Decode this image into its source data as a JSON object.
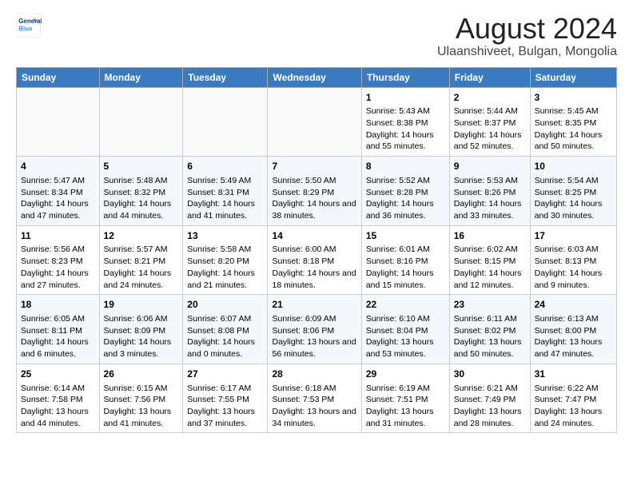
{
  "logo": {
    "text_general": "General",
    "text_blue": "Blue"
  },
  "title": "August 2024",
  "subtitle": "Ulaanshiveet, Bulgan, Mongolia",
  "days_of_week": [
    "Sunday",
    "Monday",
    "Tuesday",
    "Wednesday",
    "Thursday",
    "Friday",
    "Saturday"
  ],
  "weeks": [
    [
      {
        "day": "",
        "sunrise": "",
        "sunset": "",
        "daylight": ""
      },
      {
        "day": "",
        "sunrise": "",
        "sunset": "",
        "daylight": ""
      },
      {
        "day": "",
        "sunrise": "",
        "sunset": "",
        "daylight": ""
      },
      {
        "day": "",
        "sunrise": "",
        "sunset": "",
        "daylight": ""
      },
      {
        "day": "1",
        "sunrise": "Sunrise: 5:43 AM",
        "sunset": "Sunset: 8:38 PM",
        "daylight": "Daylight: 14 hours and 55 minutes."
      },
      {
        "day": "2",
        "sunrise": "Sunrise: 5:44 AM",
        "sunset": "Sunset: 8:37 PM",
        "daylight": "Daylight: 14 hours and 52 minutes."
      },
      {
        "day": "3",
        "sunrise": "Sunrise: 5:45 AM",
        "sunset": "Sunset: 8:35 PM",
        "daylight": "Daylight: 14 hours and 50 minutes."
      }
    ],
    [
      {
        "day": "4",
        "sunrise": "Sunrise: 5:47 AM",
        "sunset": "Sunset: 8:34 PM",
        "daylight": "Daylight: 14 hours and 47 minutes."
      },
      {
        "day": "5",
        "sunrise": "Sunrise: 5:48 AM",
        "sunset": "Sunset: 8:32 PM",
        "daylight": "Daylight: 14 hours and 44 minutes."
      },
      {
        "day": "6",
        "sunrise": "Sunrise: 5:49 AM",
        "sunset": "Sunset: 8:31 PM",
        "daylight": "Daylight: 14 hours and 41 minutes."
      },
      {
        "day": "7",
        "sunrise": "Sunrise: 5:50 AM",
        "sunset": "Sunset: 8:29 PM",
        "daylight": "Daylight: 14 hours and 38 minutes."
      },
      {
        "day": "8",
        "sunrise": "Sunrise: 5:52 AM",
        "sunset": "Sunset: 8:28 PM",
        "daylight": "Daylight: 14 hours and 36 minutes."
      },
      {
        "day": "9",
        "sunrise": "Sunrise: 5:53 AM",
        "sunset": "Sunset: 8:26 PM",
        "daylight": "Daylight: 14 hours and 33 minutes."
      },
      {
        "day": "10",
        "sunrise": "Sunrise: 5:54 AM",
        "sunset": "Sunset: 8:25 PM",
        "daylight": "Daylight: 14 hours and 30 minutes."
      }
    ],
    [
      {
        "day": "11",
        "sunrise": "Sunrise: 5:56 AM",
        "sunset": "Sunset: 8:23 PM",
        "daylight": "Daylight: 14 hours and 27 minutes."
      },
      {
        "day": "12",
        "sunrise": "Sunrise: 5:57 AM",
        "sunset": "Sunset: 8:21 PM",
        "daylight": "Daylight: 14 hours and 24 minutes."
      },
      {
        "day": "13",
        "sunrise": "Sunrise: 5:58 AM",
        "sunset": "Sunset: 8:20 PM",
        "daylight": "Daylight: 14 hours and 21 minutes."
      },
      {
        "day": "14",
        "sunrise": "Sunrise: 6:00 AM",
        "sunset": "Sunset: 8:18 PM",
        "daylight": "Daylight: 14 hours and 18 minutes."
      },
      {
        "day": "15",
        "sunrise": "Sunrise: 6:01 AM",
        "sunset": "Sunset: 8:16 PM",
        "daylight": "Daylight: 14 hours and 15 minutes."
      },
      {
        "day": "16",
        "sunrise": "Sunrise: 6:02 AM",
        "sunset": "Sunset: 8:15 PM",
        "daylight": "Daylight: 14 hours and 12 minutes."
      },
      {
        "day": "17",
        "sunrise": "Sunrise: 6:03 AM",
        "sunset": "Sunset: 8:13 PM",
        "daylight": "Daylight: 14 hours and 9 minutes."
      }
    ],
    [
      {
        "day": "18",
        "sunrise": "Sunrise: 6:05 AM",
        "sunset": "Sunset: 8:11 PM",
        "daylight": "Daylight: 14 hours and 6 minutes."
      },
      {
        "day": "19",
        "sunrise": "Sunrise: 6:06 AM",
        "sunset": "Sunset: 8:09 PM",
        "daylight": "Daylight: 14 hours and 3 minutes."
      },
      {
        "day": "20",
        "sunrise": "Sunrise: 6:07 AM",
        "sunset": "Sunset: 8:08 PM",
        "daylight": "Daylight: 14 hours and 0 minutes."
      },
      {
        "day": "21",
        "sunrise": "Sunrise: 6:09 AM",
        "sunset": "Sunset: 8:06 PM",
        "daylight": "Daylight: 13 hours and 56 minutes."
      },
      {
        "day": "22",
        "sunrise": "Sunrise: 6:10 AM",
        "sunset": "Sunset: 8:04 PM",
        "daylight": "Daylight: 13 hours and 53 minutes."
      },
      {
        "day": "23",
        "sunrise": "Sunrise: 6:11 AM",
        "sunset": "Sunset: 8:02 PM",
        "daylight": "Daylight: 13 hours and 50 minutes."
      },
      {
        "day": "24",
        "sunrise": "Sunrise: 6:13 AM",
        "sunset": "Sunset: 8:00 PM",
        "daylight": "Daylight: 13 hours and 47 minutes."
      }
    ],
    [
      {
        "day": "25",
        "sunrise": "Sunrise: 6:14 AM",
        "sunset": "Sunset: 7:58 PM",
        "daylight": "Daylight: 13 hours and 44 minutes."
      },
      {
        "day": "26",
        "sunrise": "Sunrise: 6:15 AM",
        "sunset": "Sunset: 7:56 PM",
        "daylight": "Daylight: 13 hours and 41 minutes."
      },
      {
        "day": "27",
        "sunrise": "Sunrise: 6:17 AM",
        "sunset": "Sunset: 7:55 PM",
        "daylight": "Daylight: 13 hours and 37 minutes."
      },
      {
        "day": "28",
        "sunrise": "Sunrise: 6:18 AM",
        "sunset": "Sunset: 7:53 PM",
        "daylight": "Daylight: 13 hours and 34 minutes."
      },
      {
        "day": "29",
        "sunrise": "Sunrise: 6:19 AM",
        "sunset": "Sunset: 7:51 PM",
        "daylight": "Daylight: 13 hours and 31 minutes."
      },
      {
        "day": "30",
        "sunrise": "Sunrise: 6:21 AM",
        "sunset": "Sunset: 7:49 PM",
        "daylight": "Daylight: 13 hours and 28 minutes."
      },
      {
        "day": "31",
        "sunrise": "Sunrise: 6:22 AM",
        "sunset": "Sunset: 7:47 PM",
        "daylight": "Daylight: 13 hours and 24 minutes."
      }
    ]
  ]
}
